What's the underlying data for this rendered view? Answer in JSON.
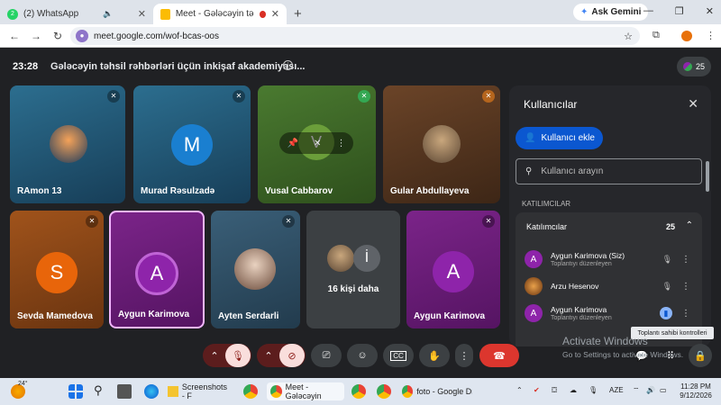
{
  "browser": {
    "tabs": [
      {
        "label": "(2) WhatsApp",
        "badge": "2",
        "color": "#25d366"
      },
      {
        "label": "Meet - Gələcəyin təhsil rəh",
        "color": "#fbbc04"
      }
    ],
    "new_tab": "+",
    "gemini": "Ask Gemini",
    "url": "meet.google.com/wof-bcas-oos"
  },
  "meeting": {
    "time": "23:28",
    "title": "Gələcəyin təhsil rəhbərləri üçün inkişaf akademiyası...",
    "participant_count": "25",
    "tiles": [
      {
        "name": "RAmon 13",
        "bg": "#1f4e79",
        "initial": ""
      },
      {
        "name": "Murad Rəsulzadə",
        "bg": "#21507a",
        "initial": "M",
        "avatarColor": "#1a7fd0"
      },
      {
        "name": "Vusal Cabbarov",
        "bg": "#3b6b2a",
        "initial": ""
      },
      {
        "name": "Gular Abdullayeva",
        "bg": "#5e3b22",
        "initial": ""
      },
      {
        "name": "Sevda Mamedova",
        "bg": "#8b4513",
        "initial": "S",
        "avatarColor": "#e8650a"
      },
      {
        "name": "Aygun Karimova",
        "bg": "#6a1a7a",
        "initial": "A",
        "avatarColor": "#8e24aa"
      },
      {
        "name": "Ayten Serdarli",
        "bg": "#2b4a5e",
        "initial": ""
      },
      {
        "name": "16 kişi daha",
        "bg": "#3c4043",
        "initial": "İ"
      },
      {
        "name": "Aygun Karimova",
        "bg": "#6a1a7a",
        "initial": "A",
        "avatarColor": "#8e24aa"
      }
    ]
  },
  "panel": {
    "title": "Kullanıcılar",
    "add_button": "Kullanıcı ekle",
    "search_placeholder": "Kullanıcı arayın",
    "section_label": "KATILIMCILAR",
    "group_label": "Katılımcılar",
    "group_count": "25",
    "people": [
      {
        "name": "Aygun Karimova (Siz)",
        "role": "Toplantıyı düzenleyen",
        "initial": "A",
        "color": "#8e24aa"
      },
      {
        "name": "Arzu Hesenov",
        "role": "",
        "initial": "",
        "color": "#b5651d"
      },
      {
        "name": "Aygun Karimova",
        "role": "Toplantıyı düzenleyen",
        "initial": "A",
        "color": "#8e24aa"
      }
    ],
    "tooltip": "Toplantı sahibi kontrolleri"
  },
  "watermark": {
    "line1": "Activate Windows",
    "line2": "Go to Settings to activate Windows."
  },
  "taskbar": {
    "weather": "24°",
    "items": [
      {
        "label": "Screenshots - F"
      },
      {
        "label": "Meet - Gələcəyin"
      },
      {
        "label": "foto - Google Driv"
      }
    ],
    "lang": "AZE",
    "time": "11:28 PM",
    "date": "9/12/2026"
  }
}
